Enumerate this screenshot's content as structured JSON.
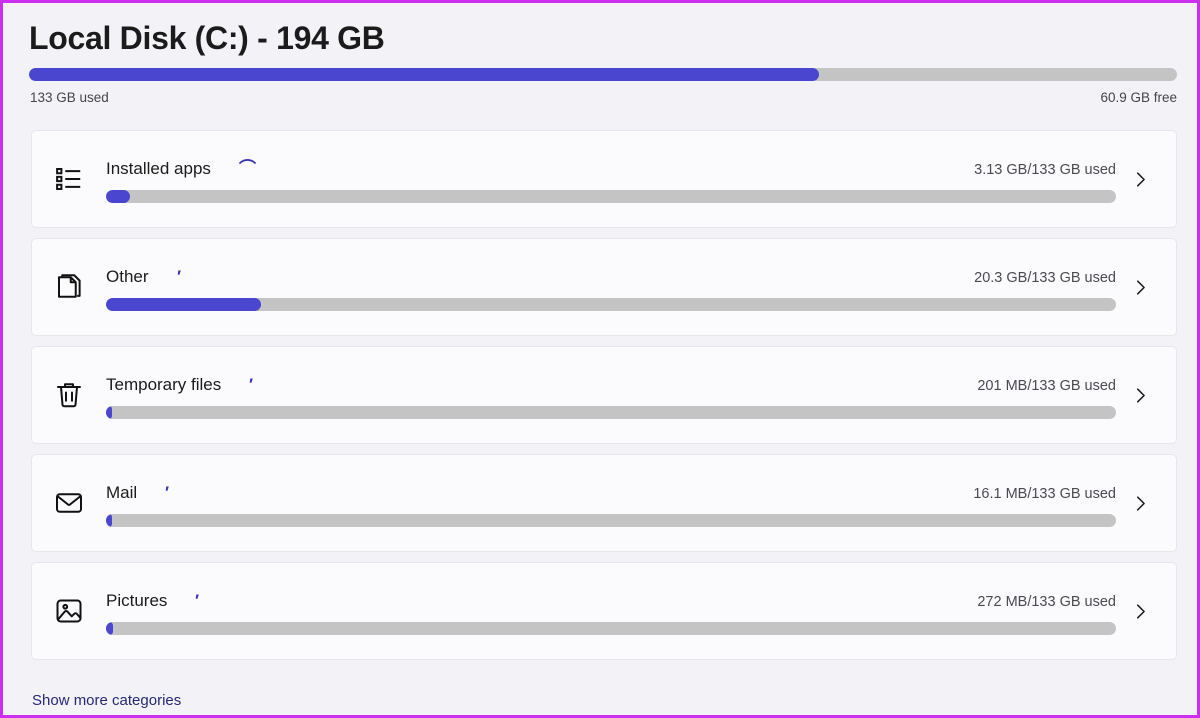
{
  "drive": {
    "title": "Local Disk (C:) - 194 GB",
    "used_label": "133 GB used",
    "free_label": "60.9 GB free",
    "used_percent": 68.8,
    "accent_color": "#4b46cf",
    "track_color": "#c4c4c4"
  },
  "categories": [
    {
      "name": "Installed apps",
      "icon": "list-icon",
      "size_label": "3.13 GB/133 GB used",
      "fill_percent": 2.4,
      "scribble": "⌒"
    },
    {
      "name": "Other",
      "icon": "folder-icon",
      "size_label": "20.3 GB/133 GB used",
      "fill_percent": 15.3,
      "scribble": "′"
    },
    {
      "name": "Temporary files",
      "icon": "trash-icon",
      "size_label": "201 MB/133 GB used",
      "fill_percent": 0.6,
      "scribble": "′"
    },
    {
      "name": "Mail",
      "icon": "mail-icon",
      "size_label": "16.1 MB/133 GB used",
      "fill_percent": 0.3,
      "scribble": "′"
    },
    {
      "name": "Pictures",
      "icon": "picture-icon",
      "size_label": "272 MB/133 GB used",
      "fill_percent": 0.7,
      "scribble": "′"
    }
  ],
  "footer": {
    "show_more_label": "Show more categories"
  }
}
